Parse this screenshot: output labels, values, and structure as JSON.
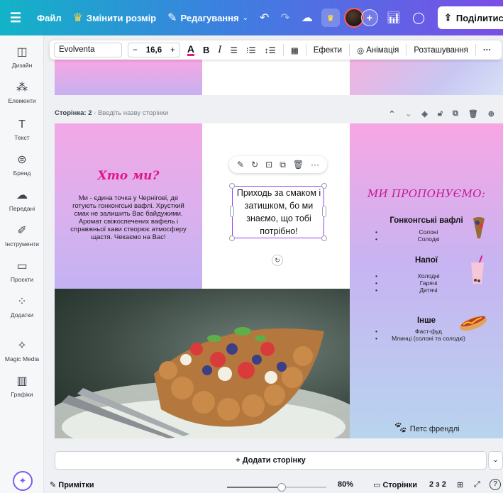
{
  "topbar": {
    "file_label": "Файл",
    "resize_label": "Змінити розмір",
    "edit_label": "Редагування",
    "share_label": "Поділитися"
  },
  "sidebar": {
    "items": [
      {
        "label": "Дизайн",
        "icon": "layout-icon"
      },
      {
        "label": "Елементи",
        "icon": "elements-icon"
      },
      {
        "label": "Текст",
        "icon": "text-icon"
      },
      {
        "label": "Бренд",
        "icon": "brand-icon"
      },
      {
        "label": "Передані",
        "icon": "uploads-icon"
      },
      {
        "label": "Інструменти",
        "icon": "tools-icon"
      },
      {
        "label": "Проєкти",
        "icon": "folder-icon"
      },
      {
        "label": "Додатки",
        "icon": "apps-icon"
      },
      {
        "label": "Magic Media",
        "icon": "magic-media-icon"
      },
      {
        "label": "Графіки",
        "icon": "charts-icon"
      }
    ]
  },
  "text_toolbar": {
    "font": "Evolventa",
    "minus": "−",
    "size": "16,6",
    "plus": "+",
    "effects": "Ефекти",
    "animation": "Анімація",
    "position": "Розташування"
  },
  "page2": {
    "label": "Сторінка: 2",
    "hint": "- Введіть назву сторінки"
  },
  "left_panel": {
    "title": "Хто ми?",
    "body": "Ми - єдина точка у Чернігові, де готують гонконгські вафлі. Хрусткий смак не залишить Вас байдужими. Аромат свіжоспечених вафель і справжньої кави створює атмосферу щастя. Чекаємо на Вас!"
  },
  "middle_panel": {
    "selected_text": "Приходь за смаком і затишком, бо ми знаємо, що тобі потрібно!"
  },
  "right_panel": {
    "title": "МИ ПРОПОНУЄМО:",
    "sections": [
      {
        "title": "Гонконгські вафлі",
        "items": [
          "Солоні",
          "Солодкі"
        ]
      },
      {
        "title": "Напої",
        "items": [
          "Холодні",
          "Гарячі",
          "Дитячі"
        ]
      },
      {
        "title": "Інше",
        "items": [
          "Фаст-фуд",
          "Млинці (солоні та солодкі)"
        ]
      }
    ],
    "footer": "Петс френдлі"
  },
  "bottom": {
    "add_page": "+ Додати сторінку",
    "notes": "Примітки",
    "zoom": "80%",
    "zoom_fraction": 0.55,
    "pages_label": "Сторінки",
    "page_counter": "2 з 2"
  },
  "colors": {
    "accent_purple": "#8b3dff",
    "title_pink": "#e0198b"
  }
}
